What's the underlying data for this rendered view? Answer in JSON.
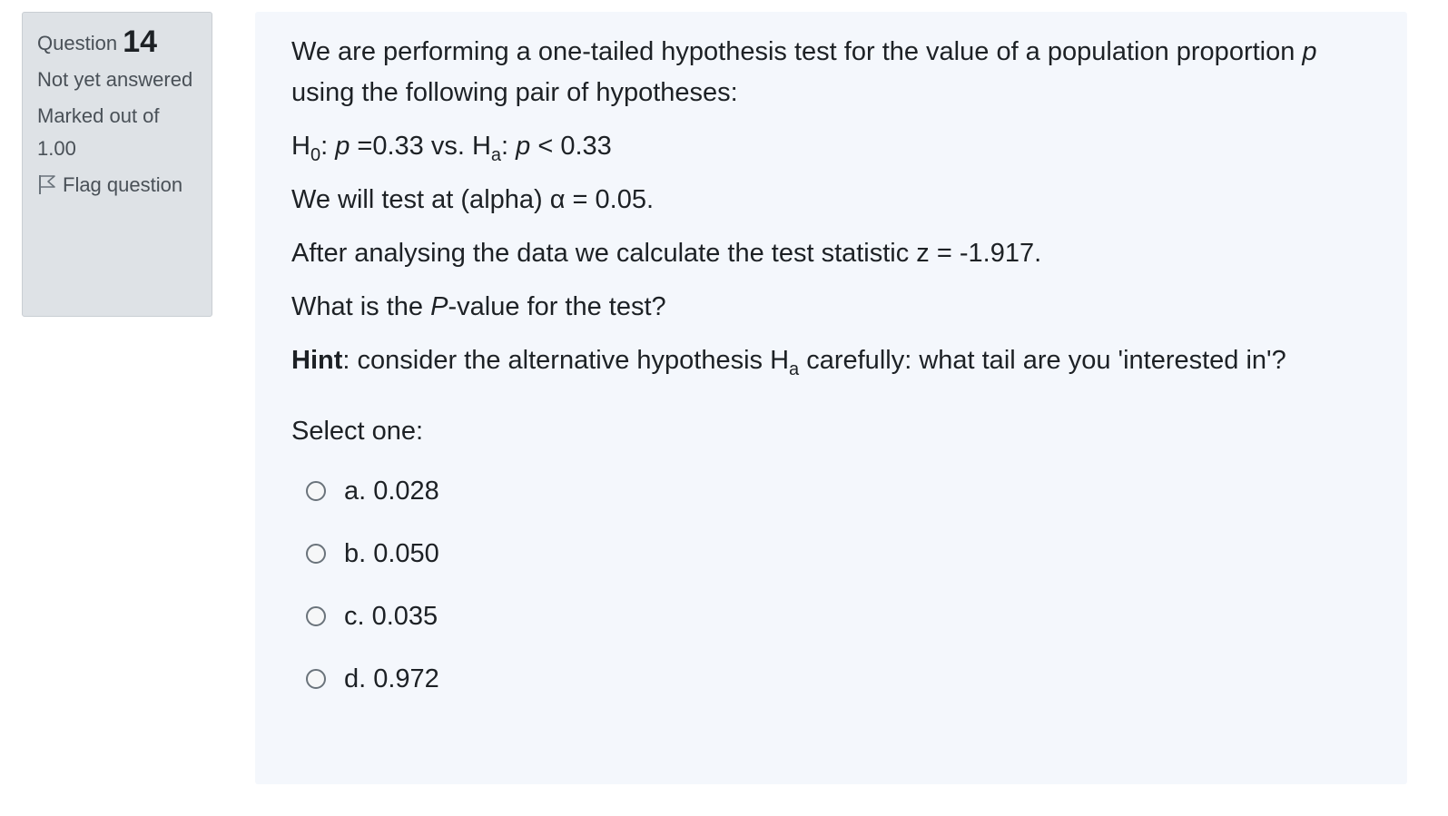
{
  "info": {
    "question_label": "Question",
    "question_number": "14",
    "status": "Not yet answered",
    "marked_out_of": "Marked out of 1.00",
    "flag_label": "Flag question"
  },
  "question": {
    "intro_1": "We are performing a one-tailed hypothesis test for the value of a population proportion",
    "intro_var": "p",
    "intro_2": "using the following pair of hypotheses:",
    "h0_H": "H",
    "h0_sub": "0",
    "h0_colon": ": ",
    "h0_var": "p",
    "h0_rest": " =0.33 vs. ",
    "ha_H": "H",
    "ha_sub": "a",
    "ha_colon": ": ",
    "ha_var": "p",
    "ha_rest": " < 0.33",
    "alpha_line": "We will test at (alpha) α = 0.05.",
    "stat_line": "After analysing the data we calculate the test statistic z = -1.917.",
    "pval_pre": "What is the ",
    "pval_var": "P",
    "pval_post": "-value for the test?",
    "hint_bold": "Hint",
    "hint_1": ": consider the alternative hypothesis H",
    "hint_sub": "a",
    "hint_2": " carefully: what tail are you 'interested in'?"
  },
  "select_label": "Select one:",
  "options": [
    {
      "label": "a. 0.028"
    },
    {
      "label": "b. 0.050"
    },
    {
      "label": "c. 0.035"
    },
    {
      "label": "d. 0.972"
    }
  ],
  "colors": {
    "info_bg": "#dee2e6",
    "panel_bg": "#f4f7fc",
    "text": "#1d2125"
  },
  "icons": {
    "flag": "flag-outline-icon",
    "radio": "radio-unchecked-icon"
  }
}
